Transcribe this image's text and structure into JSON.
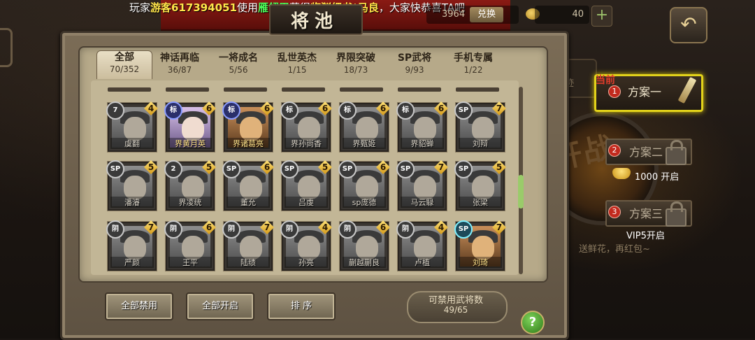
{
  "marquee": {
    "prefix": "玩家",
    "player": "游客617394051",
    "used": "使用",
    "item": "雁翎甲",
    "got": "获得",
    "reward": "临渊细书*马良",
    "suffix": "，大家快恭喜TA吧"
  },
  "resources": {
    "amount1": "3964",
    "exchange_label": "兑换",
    "amount2": "40",
    "plus_icon": "plus-icon"
  },
  "title": "将池",
  "tabs": [
    {
      "label": "全部",
      "count": "70/352"
    },
    {
      "label": "神话再临",
      "count": "36/87"
    },
    {
      "label": "一将成名",
      "count": "5/56"
    },
    {
      "label": "乱世英杰",
      "count": "1/15"
    },
    {
      "label": "界限突破",
      "count": "18/73"
    },
    {
      "label": "SP武将",
      "count": "9/93"
    },
    {
      "label": "手机专属",
      "count": "1/22"
    }
  ],
  "cards": [
    {
      "badge": "7",
      "cost": "4",
      "name": "虞翻"
    },
    {
      "badge": "标",
      "cost": "6",
      "name": "界黄月英"
    },
    {
      "badge": "标",
      "cost": "6",
      "name": "界诸葛亮"
    },
    {
      "badge": "标",
      "cost": "6",
      "name": "界孙尚香"
    },
    {
      "badge": "标",
      "cost": "6",
      "name": "界甄姬"
    },
    {
      "badge": "标",
      "cost": "6",
      "name": "界貂蝉"
    },
    {
      "badge": "SP",
      "cost": "7",
      "name": "刘辩"
    },
    {
      "badge": "SP",
      "cost": "5",
      "name": "潘濬"
    },
    {
      "badge": "2",
      "cost": "5",
      "name": "界凌统"
    },
    {
      "badge": "SP",
      "cost": "6",
      "name": "董允"
    },
    {
      "badge": "SP",
      "cost": "5",
      "name": "吕虔"
    },
    {
      "badge": "SP",
      "cost": "6",
      "name": "sp庞德"
    },
    {
      "badge": "SP",
      "cost": "7",
      "name": "马云騄"
    },
    {
      "badge": "SP",
      "cost": "5",
      "name": "张梁"
    },
    {
      "badge": "阴",
      "cost": "7",
      "name": "严颜"
    },
    {
      "badge": "阴",
      "cost": "6",
      "name": "王平"
    },
    {
      "badge": "阴",
      "cost": "7",
      "name": "陆绩"
    },
    {
      "badge": "阴",
      "cost": "4",
      "name": "孙亮"
    },
    {
      "badge": "阴",
      "cost": "6",
      "name": "蒯越蒯良"
    },
    {
      "badge": "阴",
      "cost": "4",
      "name": "卢植"
    },
    {
      "badge": "SP",
      "cost": "7",
      "name": "刘琦"
    }
  ],
  "buttons": {
    "ban_all": "全部禁用",
    "enable_all": "全部开启",
    "sort": "排 序"
  },
  "ban_count": {
    "label": "可禁用武将数",
    "value": "49/65"
  },
  "side": {
    "event_label": "点事迹",
    "current_tag": "当前",
    "plans": [
      {
        "num": "1",
        "label": "方案一"
      },
      {
        "num": "2",
        "label": "方案二"
      },
      {
        "num": "3",
        "label": "方案三"
      }
    ],
    "unlock2": "1000 开启",
    "unlock3": "VIP5开启",
    "kaizhan": "开战",
    "flower_text": "送鲜花，再红包~"
  },
  "help_label": "?"
}
